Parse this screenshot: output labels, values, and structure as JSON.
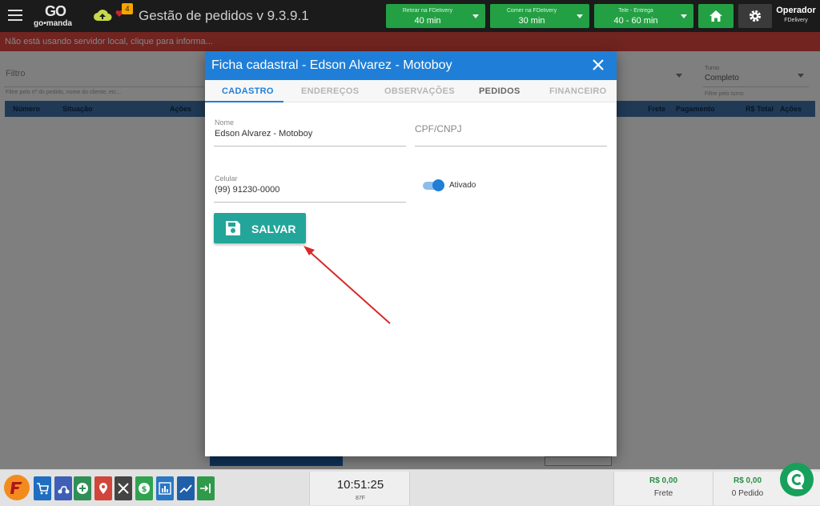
{
  "header": {
    "app_title": "Gestão de pedidos v 9.3.9.1",
    "logo_top": "GO",
    "logo_bottom": "go•manda",
    "notification_count": "4",
    "retirar": {
      "label": "Retirar na FDelivery",
      "value": "40 min"
    },
    "comer": {
      "label": "Comer na FDelivery",
      "value": "30 min"
    },
    "tele": {
      "label": "Tele - Entrega",
      "value": "40 - 60 min"
    },
    "operator_name": "Operador",
    "operator_sub": "FDelivery"
  },
  "warning": {
    "text": "Não está usando servidor local, clique para informa..."
  },
  "background": {
    "filter_label": "Filtro",
    "filter_hint": "Filtre pelo nº do pedido, nome do cliente, etc...",
    "turno_label": "Turno",
    "turno_value": "Completo",
    "turno_hint": "Filtre pelo turno",
    "columns": [
      "Número",
      "Situação",
      "Ações",
      "Frete",
      "Pagamento",
      "R$ Total",
      "Ações"
    ]
  },
  "modal": {
    "title": "Ficha cadastral - Edson Alvarez - Motoboy",
    "tabs": [
      "CADASTRO",
      "ENDEREÇOS",
      "OBSERVAÇÕES",
      "PEDIDOS",
      "FINANCEIRO"
    ],
    "nome_label": "Nome",
    "nome_value": "Edson Alvarez - Motoboy",
    "cpf_placeholder": "CPF/CNPJ",
    "celular_label": "Celular",
    "celular_value": "(99) 91230-0000",
    "ativado_label": "Ativado",
    "ativado_on": true,
    "save_label": "SALVAR"
  },
  "footer": {
    "clock": "10:51:25",
    "clock_sub": "87F",
    "frete_value": "R$ 0,00",
    "frete_label": "Frete",
    "pedido_value": "R$ 0,00",
    "pedido_label": "0 Pedido"
  },
  "colors": {
    "header_bg": "#1b1b1b",
    "warning_red": "#d9453f",
    "modal_blue": "#1f7fd8",
    "save_teal": "#23a59a",
    "status_green": "#23a043",
    "arrow_red": "#d62a2a"
  }
}
